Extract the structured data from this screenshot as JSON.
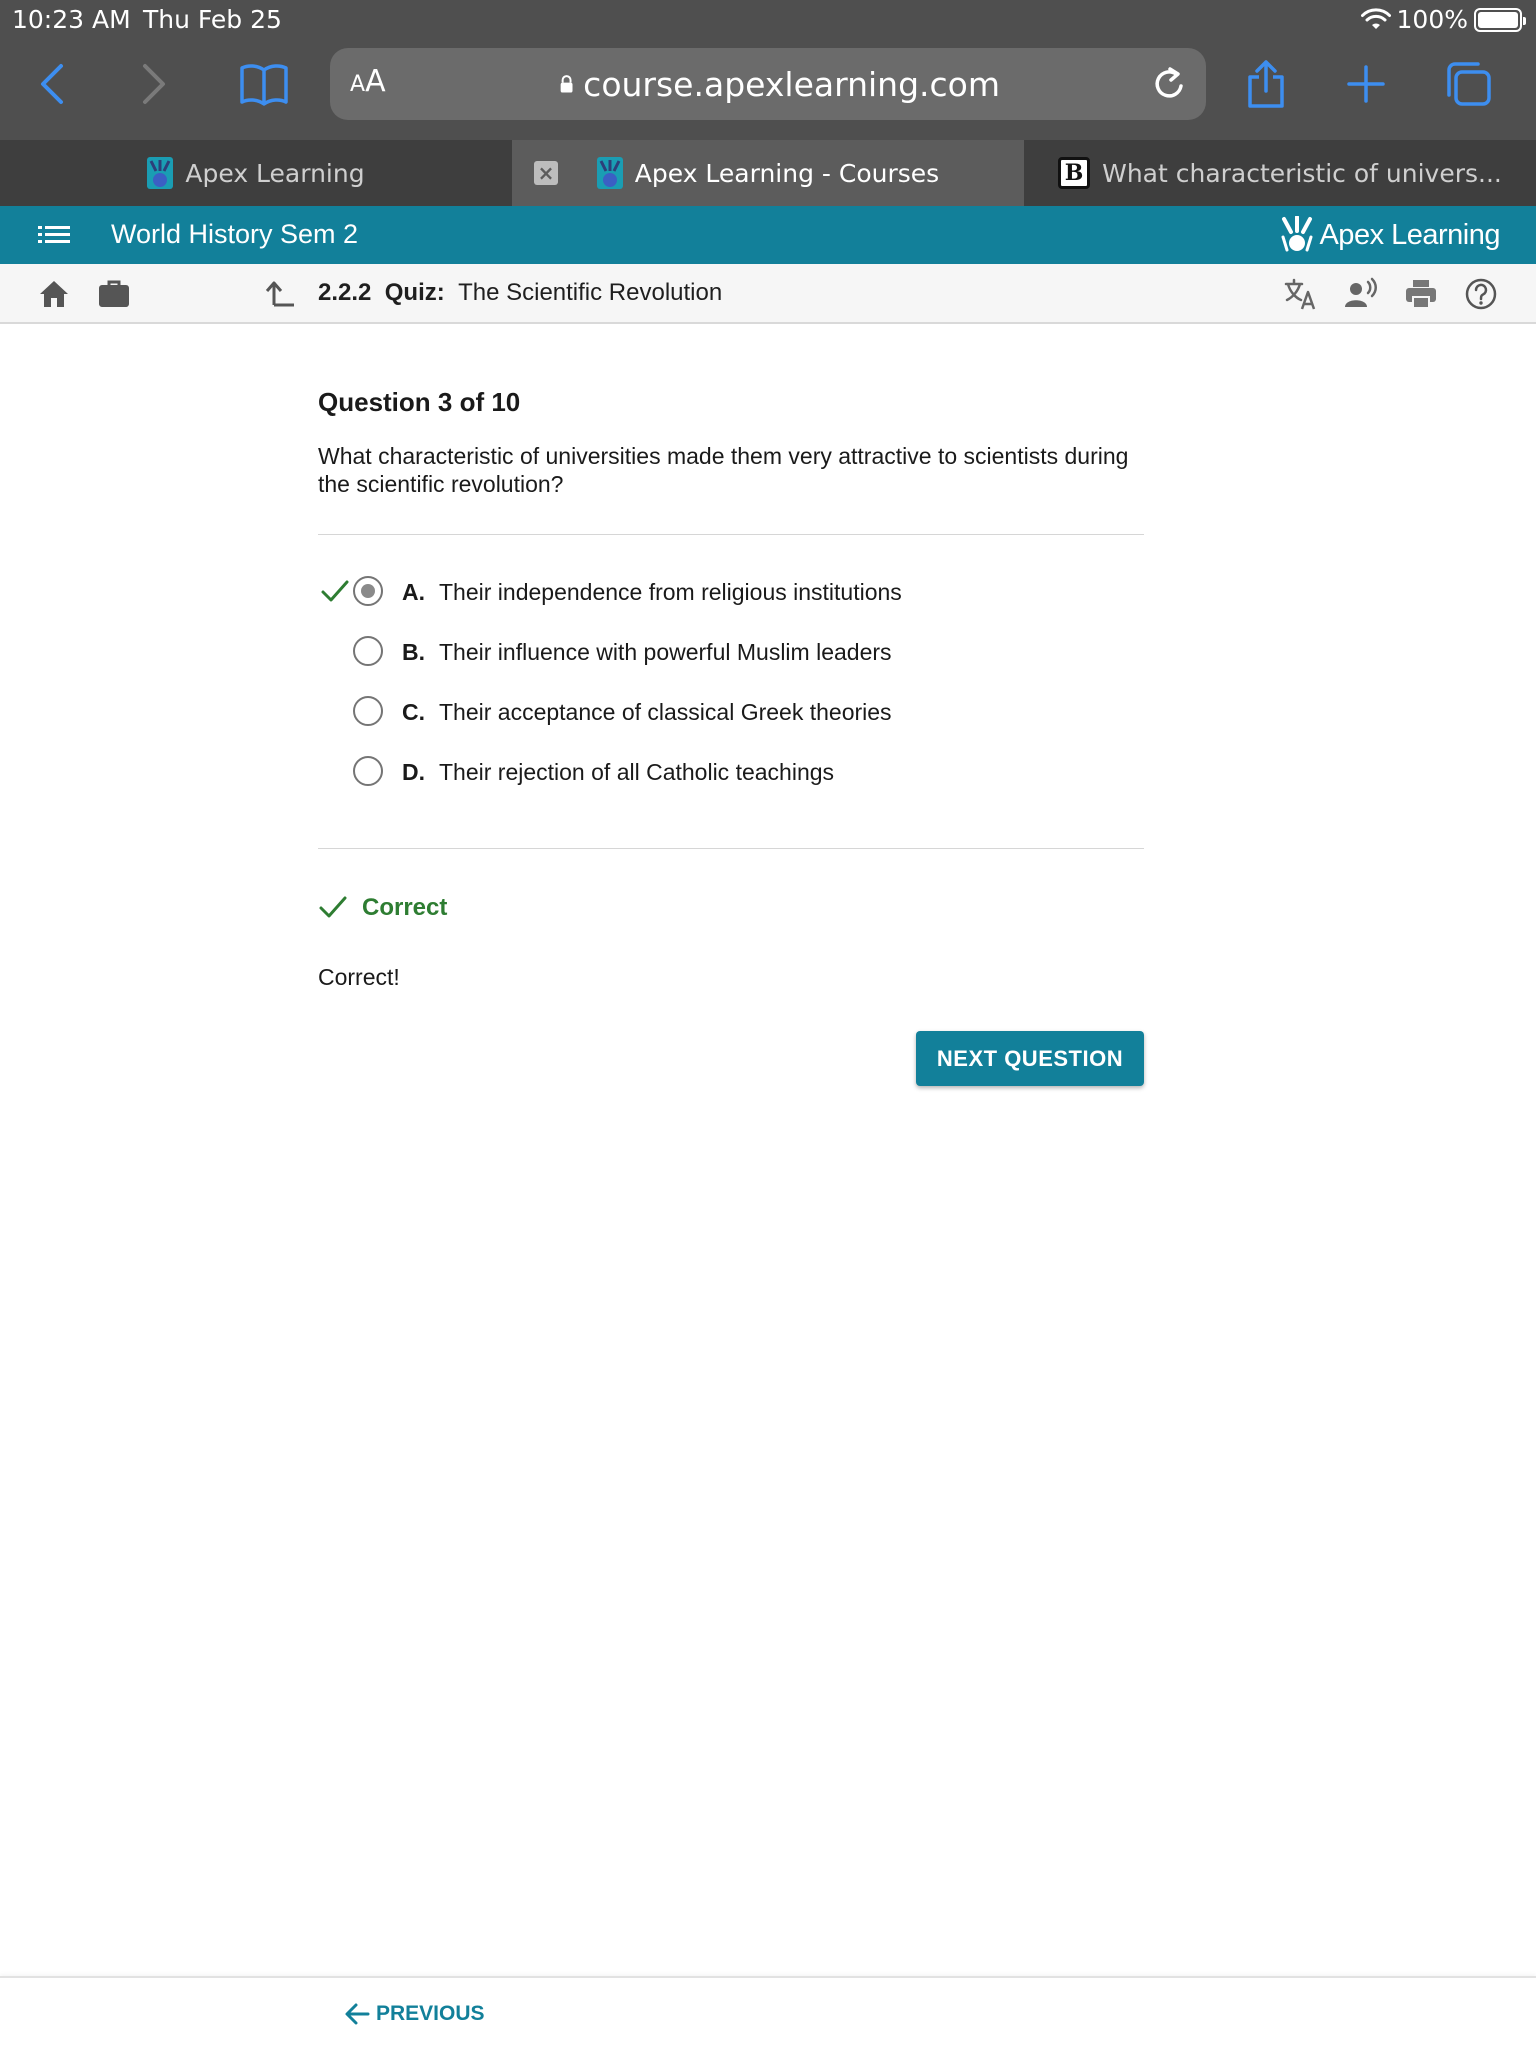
{
  "status_bar": {
    "time": "10:23 AM",
    "date": "Thu Feb 25",
    "battery": "100%"
  },
  "browser": {
    "aa_small": "A",
    "aa_large": "A",
    "url": "course.apexlearning.com",
    "tabs": [
      {
        "title": "Apex Learning",
        "active": false
      },
      {
        "title": "Apex Learning - Courses",
        "active": true
      },
      {
        "title": "What characteristic of univers...",
        "active": false
      }
    ],
    "favicon_b": "B"
  },
  "course": {
    "title": "World History Sem 2",
    "brand": "Apex Learning"
  },
  "quiz": {
    "number": "2.2.2",
    "type": "Quiz:",
    "title": "The Scientific Revolution"
  },
  "question": {
    "counter": "Question 3 of 10",
    "text": "What characteristic of universities made them very attractive to scientists during the scientific revolution?",
    "options": [
      {
        "letter": "A.",
        "text": "Their independence from religious institutions",
        "selected": true,
        "marked_correct": true
      },
      {
        "letter": "B.",
        "text": "Their influence with powerful Muslim leaders",
        "selected": false
      },
      {
        "letter": "C.",
        "text": "Their acceptance of classical Greek theories",
        "selected": false
      },
      {
        "letter": "D.",
        "text": "Their rejection of all Catholic teachings",
        "selected": false
      }
    ]
  },
  "result": {
    "label": "Correct",
    "feedback": "Correct!"
  },
  "actions": {
    "next": "NEXT QUESTION",
    "previous": "PREVIOUS"
  },
  "colors": {
    "teal": "#12809a",
    "correct_green": "#2e7d32",
    "browser_chrome": "#4f4f4f",
    "ios_blue": "#3d8ef0"
  }
}
